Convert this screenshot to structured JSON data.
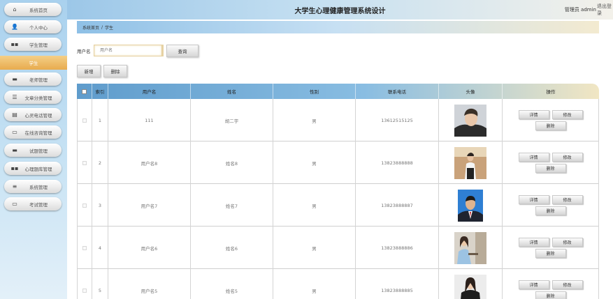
{
  "header": {
    "title": "大学生心理健康管理系统设计",
    "user": "管理员 admin",
    "logout": "退出登录"
  },
  "sidebar": {
    "items": [
      {
        "label": "系统首页",
        "icon": "home-icon"
      },
      {
        "label": "个人中心",
        "icon": "user-icon"
      },
      {
        "label": "学生管理",
        "icon": "grid-icon"
      },
      {
        "label": "老师管理",
        "icon": "book-icon"
      },
      {
        "label": "文章分类管理",
        "icon": "list-icon"
      },
      {
        "label": "心灵电话管理",
        "icon": "document-icon"
      },
      {
        "label": "在线咨询管理",
        "icon": "monitor-icon"
      },
      {
        "label": "试题管理",
        "icon": "book-icon"
      },
      {
        "label": "心理题库管理",
        "icon": "grid-icon"
      },
      {
        "label": "系统管理",
        "icon": "menu-icon"
      },
      {
        "label": "考试管理",
        "icon": "monitor-icon"
      }
    ],
    "active_sub": "学生"
  },
  "breadcrumb": {
    "home": "系统首页",
    "separator": "/",
    "current": "学生"
  },
  "search": {
    "label": "用户名",
    "placeholder": "用户名",
    "button": "查询"
  },
  "actions": {
    "add": "新增",
    "delete": "删除"
  },
  "table": {
    "columns": [
      "索引",
      "用户名",
      "姓名",
      "性别",
      "联系电话",
      "头像",
      "操作"
    ],
    "rows": [
      {
        "index": "1",
        "username": "111",
        "name": "胡二宇",
        "gender": "男",
        "phone": "13612515125"
      },
      {
        "index": "2",
        "username": "用户名8",
        "name": "姓名8",
        "gender": "男",
        "phone": "13823888888"
      },
      {
        "index": "3",
        "username": "用户名7",
        "name": "姓名7",
        "gender": "男",
        "phone": "13823888887"
      },
      {
        "index": "4",
        "username": "用户名6",
        "name": "姓名6",
        "gender": "男",
        "phone": "13823888886"
      },
      {
        "index": "5",
        "username": "用户名5",
        "name": "姓名5",
        "gender": "男",
        "phone": "13823888885"
      }
    ],
    "row_actions": {
      "detail": "详情",
      "edit": "修改",
      "delete": "删除"
    }
  },
  "colors": {
    "accent_orange": "#e8ab4e",
    "header_blue": "#9cc7e8",
    "table_head_blue": "#5f9ccc"
  }
}
